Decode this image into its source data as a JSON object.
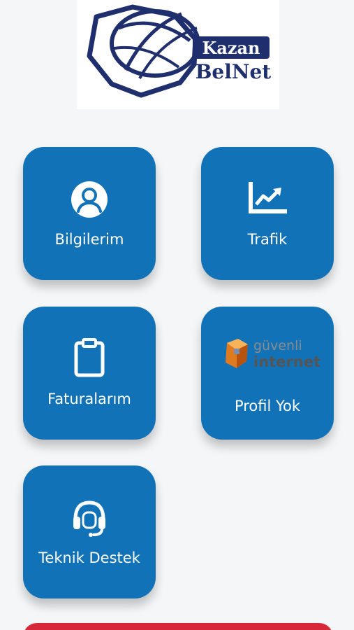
{
  "logo": {
    "line1": "Kazan",
    "line2": "BelNet",
    "color": "#1f2f6e"
  },
  "colors": {
    "tile": "#1272b8",
    "logout": "#d7283a",
    "background": "#f5f6f8"
  },
  "tiles": [
    {
      "label": "Bilgilerim",
      "icon": "user-circle-icon"
    },
    {
      "label": "Trafik",
      "icon": "chart-line-icon"
    },
    {
      "label": "Faturalarım",
      "icon": "clipboard-icon"
    },
    {
      "label": "Profil Yok",
      "icon": "guvenli-internet-logo",
      "logo_line1": "güvenli",
      "logo_line2": "internet"
    },
    {
      "label": "Teknik Destek",
      "icon": "headset-icon"
    }
  ]
}
